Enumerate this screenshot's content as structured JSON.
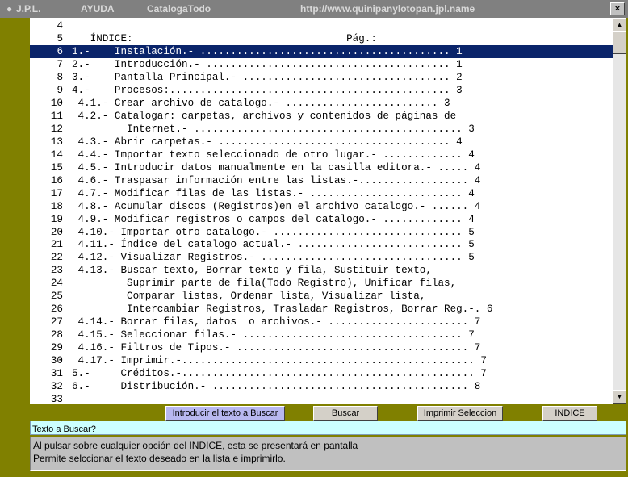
{
  "titlebar": {
    "app": "J.P.L.",
    "menu_help": "AYUDA",
    "doc": "CatalogaTodo",
    "url": "http://www.quinipanylotopan.jpl.name",
    "close": "×"
  },
  "list": {
    "selected_index": 2,
    "rows": [
      {
        "num": "4",
        "text": ""
      },
      {
        "num": "5",
        "text": "   ÍNDICE:                                   Pág.:"
      },
      {
        "num": "6",
        "text": "1.-    Instalación.- ......................................... 1"
      },
      {
        "num": "7",
        "text": "2.-    Introducción.- ........................................ 1"
      },
      {
        "num": "8",
        "text": "3.-    Pantalla Principal.- .................................. 2"
      },
      {
        "num": "9",
        "text": "4.-    Procesos:.............................................. 3"
      },
      {
        "num": "10",
        "text": " 4.1.- Crear archivo de catalogo.- ......................... 3"
      },
      {
        "num": "11",
        "text": " 4.2.- Catalogar: carpetas, archivos y contenidos de páginas de"
      },
      {
        "num": "12",
        "text": "         Internet.- ............................................ 3"
      },
      {
        "num": "13",
        "text": " 4.3.- Abrir carpetas.- ...................................... 4"
      },
      {
        "num": "14",
        "text": " 4.4.- Importar texto seleccionado de otro lugar.- ............. 4"
      },
      {
        "num": "15",
        "text": " 4.5.- Introducir datos manualmente en la casilla editora.- ..... 4"
      },
      {
        "num": "16",
        "text": " 4.6.- Traspasar información entre las listas.-.................. 4"
      },
      {
        "num": "17",
        "text": " 4.7.- Modificar filas de las listas.- ......................... 4"
      },
      {
        "num": "18",
        "text": " 4.8.- Acumular discos (Registros)en el archivo catalogo.- ...... 4"
      },
      {
        "num": "19",
        "text": " 4.9.- Modificar registros o campos del catalogo.- ............. 4"
      },
      {
        "num": "20",
        "text": " 4.10.- Importar otro catalogo.- ............................... 5"
      },
      {
        "num": "21",
        "text": " 4.11.- Índice del catalogo actual.- ........................... 5"
      },
      {
        "num": "22",
        "text": " 4.12.- Visualizar Registros.- ................................. 5"
      },
      {
        "num": "23",
        "text": " 4.13.- Buscar texto, Borrar texto y fila, Sustituir texto,"
      },
      {
        "num": "24",
        "text": "         Suprimir parte de fila(Todo Registro), Unificar filas,"
      },
      {
        "num": "25",
        "text": "         Comparar listas, Ordenar lista, Visualizar lista,"
      },
      {
        "num": "26",
        "text": "         Intercambiar Registros, Trasladar Registros, Borrar Reg.-. 6"
      },
      {
        "num": "27",
        "text": " 4.14.- Borrar filas, datos  o archivos.- ....................... 7"
      },
      {
        "num": "28",
        "text": " 4.15.- Seleccionar filas.- .................................... 7"
      },
      {
        "num": "29",
        "text": " 4.16.- Filtros de Tipos.- ...................................... 7"
      },
      {
        "num": "30",
        "text": " 4.17.- Imprimir.-................................................ 7"
      },
      {
        "num": "31",
        "text": "5.-     Créditos.-................................................ 7"
      },
      {
        "num": "32",
        "text": "6.-     Distribución.- .......................................... 8"
      },
      {
        "num": "33",
        "text": ""
      }
    ]
  },
  "buttons": {
    "introducir": "Introducir el texto a Buscar",
    "buscar": "Buscar",
    "imprimir": "Imprimir Seleccion",
    "indice": "INDICE"
  },
  "search": {
    "value": "Texto a Buscar?"
  },
  "help": {
    "line1": "Al pulsar sobre cualquier opción del INDICE, esta se presentará en pantalla",
    "line2": "Permite selccionar el texto deseado en la lista e imprimirlo."
  },
  "icons": {
    "scroll_up": "▲",
    "scroll_down": "▼"
  }
}
